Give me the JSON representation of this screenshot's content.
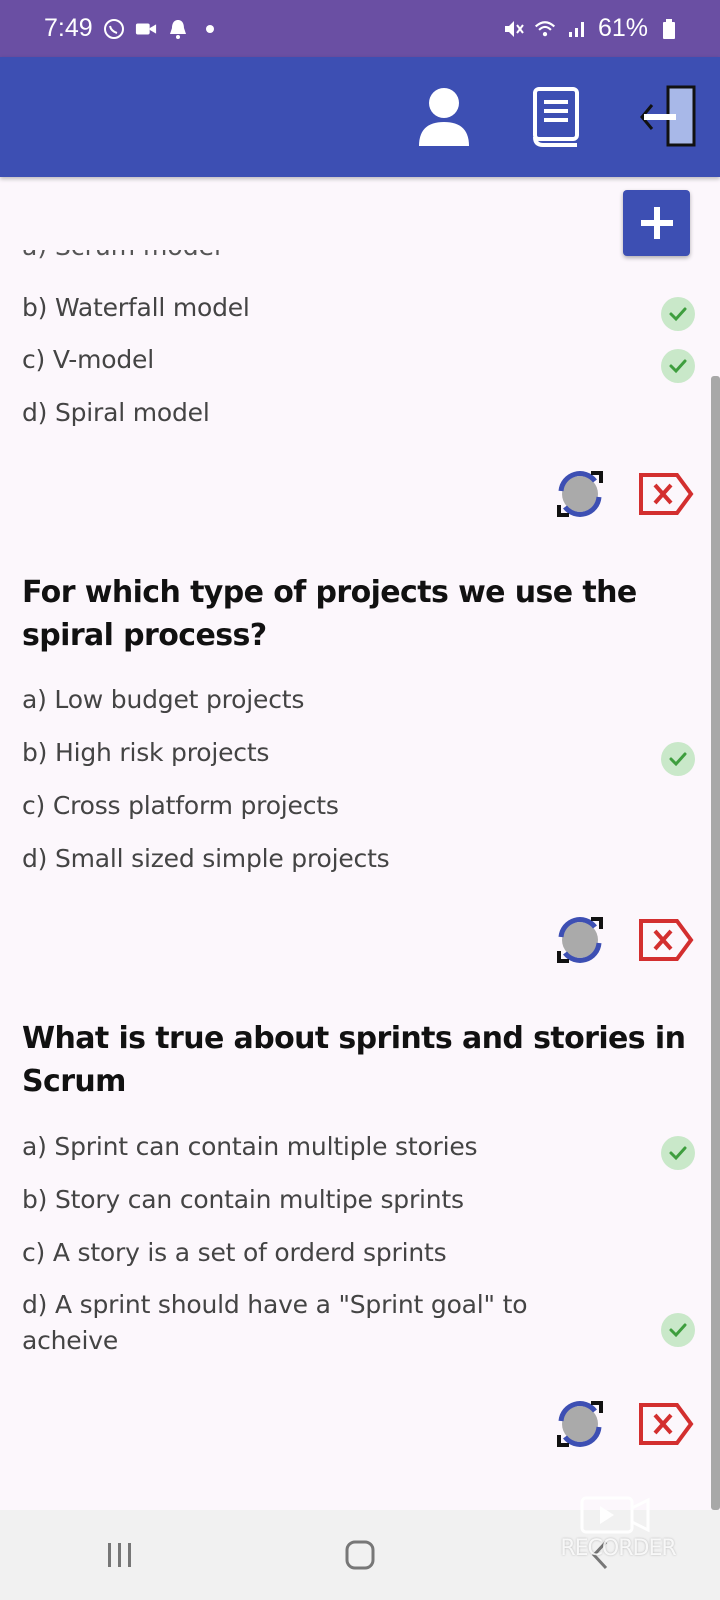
{
  "status_bar": {
    "time": "7:49",
    "battery": "61%"
  },
  "app_bar": {
    "icons": [
      "person-icon",
      "book-icon",
      "logout-icon"
    ]
  },
  "partial_option": "a) Scrum model",
  "questions": [
    {
      "question": "",
      "options": [
        {
          "label": "b) Waterfall model",
          "correct": true
        },
        {
          "label": "c) V-model",
          "correct": true
        },
        {
          "label": "d) Spiral model",
          "correct": false
        }
      ]
    },
    {
      "question": "For which type of projects we use the spiral process?",
      "options": [
        {
          "label": "a) Low budget projects",
          "correct": false
        },
        {
          "label": "b) High risk projects",
          "correct": true
        },
        {
          "label": "c) Cross platform projects",
          "correct": false
        },
        {
          "label": "d) Small sized simple projects",
          "correct": false
        }
      ]
    },
    {
      "question": "What is true about sprints and stories in Scrum",
      "options": [
        {
          "label": "a) Sprint can contain multiple stories",
          "correct": true
        },
        {
          "label": "b) Story can contain multipe sprints",
          "correct": false
        },
        {
          "label": "c) A story is a set of orderd sprints",
          "correct": false
        },
        {
          "label": "d) A sprint should have a \"Sprint goal\" to acheive",
          "correct": true
        }
      ]
    }
  ],
  "colors": {
    "accent": "#3d4fb3",
    "status_bar": "#6a4fa3",
    "check_bg": "#c9e8c9",
    "check": "#3e9e3e",
    "delete": "#d32f2f"
  },
  "watermark": "RECORDER"
}
